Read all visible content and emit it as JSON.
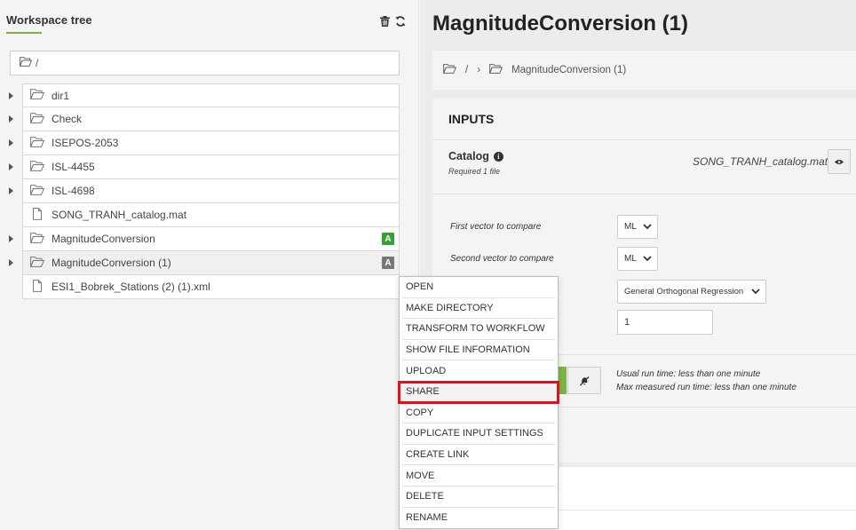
{
  "workspace": {
    "title": "Workspace tree",
    "path": "/",
    "items": [
      {
        "name": "dir1",
        "type": "folder",
        "expandable": true
      },
      {
        "name": "Check",
        "type": "folder",
        "expandable": true
      },
      {
        "name": "ISEPOS-2053",
        "type": "folder",
        "expandable": true
      },
      {
        "name": "ISL-4455",
        "type": "folder",
        "expandable": true
      },
      {
        "name": "ISL-4698",
        "type": "folder",
        "expandable": true
      },
      {
        "name": "SONG_TRANH_catalog.mat",
        "type": "file",
        "expandable": false
      },
      {
        "name": "MagnitudeConversion",
        "type": "folder",
        "expandable": true,
        "badge": "A",
        "badge_color": "#37a137"
      },
      {
        "name": "MagnitudeConversion (1)",
        "type": "folder",
        "expandable": true,
        "badge": "A",
        "badge_color": "#777777",
        "selected": true
      },
      {
        "name": "ESI1_Bobrek_Stations (2) (1).xml",
        "type": "file",
        "expandable": false
      }
    ]
  },
  "main": {
    "title": "MagnitudeConversion (1)",
    "breadcrumb": [
      "/",
      "MagnitudeConversion (1)"
    ],
    "inputs": {
      "heading": "INPUTS",
      "catalog": {
        "label": "Catalog",
        "required": "Required 1 file",
        "file": "SONG_TRANH_catalog.mat"
      },
      "fields": [
        {
          "label": "First vector to compare",
          "value": "ML"
        },
        {
          "label": "Second vector to compare",
          "value": "ML"
        },
        {
          "label": "",
          "value": "General Orthogonal Regression"
        },
        {
          "label": "",
          "value": "1"
        }
      ],
      "runtime": {
        "usual": "Usual run time: less than one minute",
        "max": "Max measured run time: less than one minute"
      }
    }
  },
  "context_menu": {
    "items": [
      "OPEN",
      "MAKE DIRECTORY",
      "TRANSFORM TO WORKFLOW",
      "SHOW FILE INFORMATION",
      "UPLOAD",
      "SHARE",
      "COPY",
      "DUPLICATE INPUT SETTINGS",
      "CREATE LINK",
      "MOVE",
      "DELETE",
      "RENAME"
    ],
    "highlighted": "SHARE",
    "highlight_color": "#e0111f"
  }
}
